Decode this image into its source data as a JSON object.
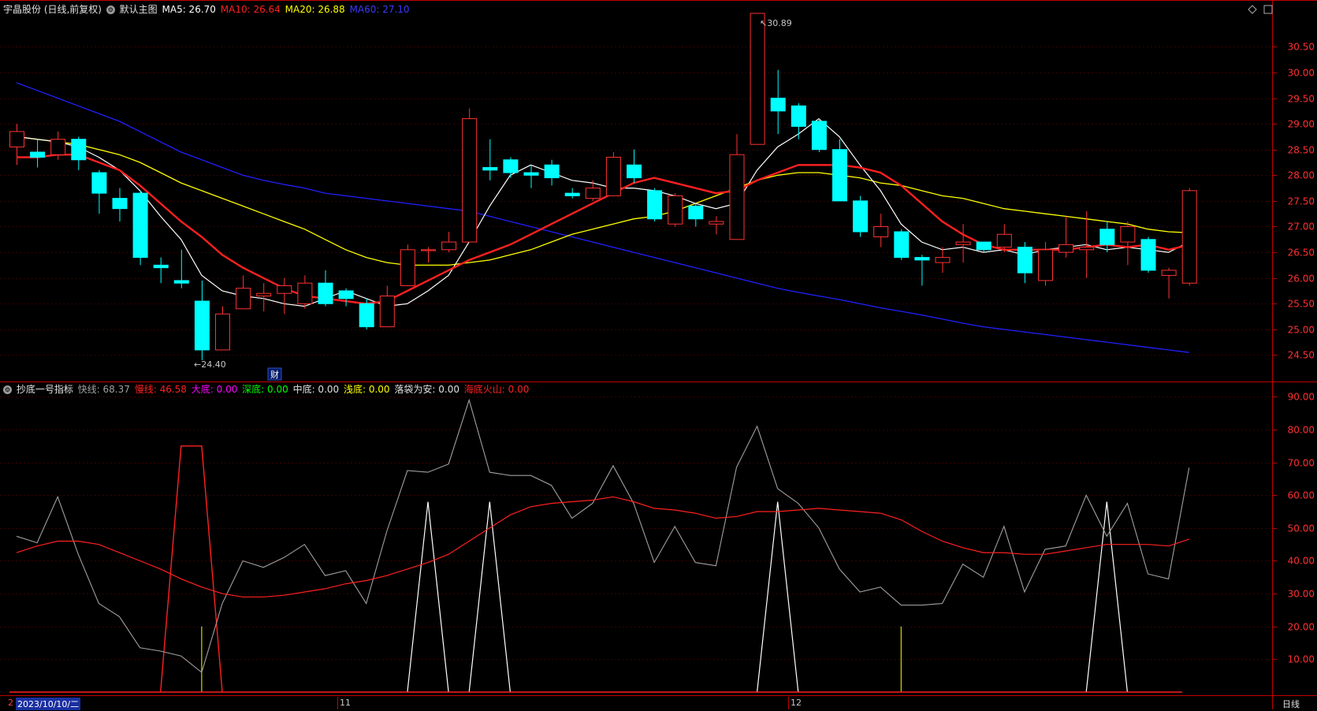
{
  "colors": {
    "background": "#000000",
    "frame": "#c00000",
    "up": "#ff3232",
    "down": "#00ffff",
    "ma5": "#ffffff",
    "ma10": "#ff2020",
    "ma20": "#ffff00",
    "ma60": "#2020ff"
  },
  "header": {
    "stock_title": "宇晶股份 (日线,前复权)",
    "template_label": "默认主图",
    "ma5": "MA5: 26.70",
    "ma10": "MA10: 26.64",
    "ma20": "MA20: 26.88",
    "ma60": "MA60: 27.10"
  },
  "indicator_header": {
    "name": "抄底一号指标",
    "fast": "快线: 68.37",
    "slow": "慢线: 46.58",
    "big_bottom": "大底: 0.00",
    "deep_bottom": "深底: 0.00",
    "mid_bottom": "中底: 0.00",
    "shallow_bottom": "浅底: 0.00",
    "safe": "落袋为安: 0.00",
    "volcano": "海底火山: 0.00"
  },
  "annotations": {
    "high_label": "30.89",
    "low_label": "24.40",
    "finance_marker": "财"
  },
  "xaxis": {
    "first_date": "2023/10/10/二",
    "month_11": "11",
    "month_12": "12",
    "period": "日线",
    "left_marker": "2"
  },
  "chart_data": [
    {
      "type": "candlestick",
      "title": "宇晶股份 (日线,前复权)",
      "ylim": [
        24.2,
        30.95
      ],
      "yticks": [
        "24.50",
        "25.00",
        "25.50",
        "26.00",
        "26.50",
        "27.00",
        "27.50",
        "28.00",
        "28.50",
        "29.00",
        "29.50",
        "30.00",
        "30.50"
      ],
      "candles": [
        [
          28.55,
          28.85,
          29.0,
          28.2
        ],
        [
          28.45,
          28.35,
          28.7,
          28.15
        ],
        [
          28.4,
          28.7,
          28.85,
          28.3
        ],
        [
          28.7,
          28.3,
          28.75,
          28.1
        ],
        [
          28.05,
          27.65,
          28.1,
          27.25
        ],
        [
          27.55,
          27.35,
          27.75,
          27.1
        ],
        [
          27.65,
          26.4,
          27.7,
          26.25
        ],
        [
          26.25,
          26.2,
          26.4,
          25.9
        ],
        [
          25.95,
          25.9,
          26.55,
          25.8
        ],
        [
          25.55,
          24.6,
          25.95,
          24.4
        ],
        [
          24.6,
          25.3,
          25.45,
          24.6
        ],
        [
          25.4,
          25.8,
          26.05,
          25.4
        ],
        [
          25.65,
          25.7,
          25.9,
          25.35
        ],
        [
          25.7,
          25.85,
          26.0,
          25.3
        ],
        [
          25.5,
          25.9,
          26.05,
          25.4
        ],
        [
          25.9,
          25.5,
          26.15,
          25.45
        ],
        [
          25.75,
          25.6,
          25.8,
          25.45
        ],
        [
          25.5,
          25.05,
          25.6,
          25.0
        ],
        [
          25.05,
          25.65,
          25.85,
          25.05
        ],
        [
          25.85,
          26.55,
          26.65,
          25.85
        ],
        [
          26.55,
          26.55,
          26.6,
          26.3
        ],
        [
          26.55,
          26.7,
          26.9,
          26.5
        ],
        [
          26.7,
          29.1,
          29.3,
          26.7
        ],
        [
          28.15,
          28.1,
          28.7,
          27.9
        ],
        [
          28.3,
          28.05,
          28.35,
          27.95
        ],
        [
          28.05,
          28.0,
          28.2,
          27.75
        ],
        [
          28.2,
          27.95,
          28.3,
          27.8
        ],
        [
          27.65,
          27.6,
          27.75,
          27.55
        ],
        [
          27.55,
          27.75,
          27.9,
          27.5
        ],
        [
          27.6,
          28.35,
          28.45,
          27.6
        ],
        [
          28.2,
          27.95,
          28.5,
          27.85
        ],
        [
          27.7,
          27.15,
          27.75,
          27.1
        ],
        [
          27.05,
          27.6,
          27.65,
          27.0
        ],
        [
          27.4,
          27.15,
          27.45,
          27.0
        ],
        [
          27.05,
          27.1,
          27.2,
          26.85
        ],
        [
          26.75,
          28.4,
          28.8,
          26.75
        ],
        [
          28.6,
          31.15,
          30.89,
          28.6
        ],
        [
          29.5,
          29.25,
          30.05,
          28.8
        ],
        [
          29.35,
          28.95,
          29.4,
          28.7
        ],
        [
          29.05,
          28.5,
          29.1,
          28.45
        ],
        [
          28.5,
          27.5,
          28.7,
          27.5
        ],
        [
          27.5,
          26.9,
          27.6,
          26.8
        ],
        [
          26.8,
          27.0,
          27.25,
          26.6
        ],
        [
          26.9,
          26.4,
          26.95,
          26.35
        ],
        [
          26.4,
          26.35,
          26.45,
          25.85
        ],
        [
          26.3,
          26.4,
          26.6,
          26.1
        ],
        [
          26.65,
          26.7,
          27.05,
          26.3
        ],
        [
          26.7,
          26.55,
          26.7,
          26.5
        ],
        [
          26.6,
          26.85,
          27.05,
          26.5
        ],
        [
          26.6,
          26.1,
          26.7,
          25.9
        ],
        [
          25.95,
          26.55,
          26.7,
          25.85
        ],
        [
          26.5,
          26.65,
          27.2,
          26.4
        ],
        [
          26.55,
          26.6,
          27.3,
          26.0
        ],
        [
          26.95,
          26.65,
          27.1,
          26.5
        ],
        [
          26.7,
          27.0,
          27.1,
          26.25
        ],
        [
          26.75,
          26.15,
          26.8,
          26.1
        ],
        [
          26.05,
          26.15,
          26.2,
          25.6
        ],
        [
          25.9,
          27.7,
          27.75,
          25.85
        ]
      ],
      "ma5": [
        28.75,
        28.7,
        28.65,
        28.55,
        28.35,
        28.1,
        27.7,
        27.2,
        26.75,
        26.05,
        25.75,
        25.65,
        25.6,
        25.5,
        25.45,
        25.6,
        25.75,
        25.6,
        25.45,
        25.5,
        25.75,
        26.05,
        26.7,
        27.4,
        28.0,
        28.2,
        28.05,
        27.9,
        27.85,
        27.75,
        27.75,
        27.7,
        27.6,
        27.45,
        27.35,
        27.45,
        28.1,
        28.55,
        28.8,
        29.1,
        28.75,
        28.2,
        27.7,
        27.05,
        26.7,
        26.55,
        26.6,
        26.5,
        26.55,
        26.45,
        26.55,
        26.6,
        26.65,
        26.55,
        26.6,
        26.55,
        26.5,
        26.7
      ],
      "ma10": [
        28.35,
        28.35,
        28.4,
        28.4,
        28.25,
        28.1,
        27.8,
        27.45,
        27.1,
        26.8,
        26.45,
        26.2,
        26.0,
        25.8,
        25.65,
        25.6,
        25.55,
        25.5,
        25.55,
        25.75,
        25.95,
        26.15,
        26.35,
        26.5,
        26.65,
        26.85,
        27.05,
        27.25,
        27.45,
        27.65,
        27.85,
        27.95,
        27.85,
        27.75,
        27.65,
        27.7,
        27.9,
        28.05,
        28.2,
        28.2,
        28.2,
        28.15,
        28.05,
        27.8,
        27.45,
        27.1,
        26.85,
        26.65,
        26.55,
        26.55,
        26.55,
        26.55,
        26.6,
        26.65,
        26.6,
        26.65,
        26.55,
        26.64
      ],
      "ma20": [
        28.75,
        28.7,
        28.65,
        28.6,
        28.5,
        28.4,
        28.25,
        28.05,
        27.85,
        27.7,
        27.55,
        27.4,
        27.25,
        27.1,
        26.95,
        26.75,
        26.55,
        26.4,
        26.3,
        26.25,
        26.25,
        26.25,
        26.3,
        26.35,
        26.45,
        26.55,
        26.7,
        26.85,
        26.95,
        27.05,
        27.15,
        27.2,
        27.3,
        27.45,
        27.6,
        27.75,
        27.9,
        28.0,
        28.05,
        28.05,
        28.0,
        27.95,
        27.85,
        27.8,
        27.7,
        27.6,
        27.55,
        27.45,
        27.35,
        27.3,
        27.25,
        27.2,
        27.15,
        27.1,
        27.05,
        26.95,
        26.9,
        26.88
      ],
      "ma60": [
        29.8,
        29.65,
        29.5,
        29.35,
        29.2,
        29.05,
        28.85,
        28.65,
        28.45,
        28.3,
        28.15,
        28.0,
        27.9,
        27.82,
        27.75,
        27.65,
        27.6,
        27.55,
        27.5,
        27.45,
        27.4,
        27.35,
        27.3,
        27.2,
        27.1,
        27.0,
        26.9,
        26.8,
        26.7,
        26.6,
        26.5,
        26.4,
        26.3,
        26.2,
        26.1,
        26.0,
        25.9,
        25.8,
        25.72,
        25.65,
        25.58,
        25.5,
        25.42,
        25.35,
        25.28,
        25.2,
        25.12,
        25.05,
        25.0,
        24.95,
        24.9,
        24.85,
        24.8,
        24.75,
        24.7,
        24.65,
        24.6,
        24.55
      ]
    },
    {
      "type": "line",
      "title": "抄底一号指标",
      "ylim": [
        0,
        92
      ],
      "yticks": [
        "10.00",
        "20.00",
        "30.00",
        "40.00",
        "50.00",
        "60.00",
        "70.00",
        "80.00",
        "90.00"
      ],
      "series": [
        {
          "name": "快线",
          "values": [
            47.5,
            45.5,
            59.5,
            42.0,
            27.0,
            23.0,
            13.5,
            12.5,
            11.0,
            6.0,
            27.0,
            40.0,
            38.0,
            41.0,
            45.0,
            35.5,
            37.0,
            27.0,
            49.0,
            67.5,
            67.0,
            69.5,
            89.0,
            67.0,
            66.0,
            66.0,
            63.0,
            53.0,
            57.5,
            69.0,
            57.5,
            39.5,
            50.5,
            39.5,
            38.5,
            68.5,
            81.0,
            62.0,
            57.5,
            50.0,
            37.5,
            30.5,
            32.0,
            26.5,
            26.5,
            27.0,
            39.0,
            35.0,
            50.5,
            30.5,
            43.5,
            44.5,
            60.0,
            47.5,
            57.5,
            36.0,
            34.5,
            68.37
          ]
        },
        {
          "name": "慢线",
          "values": [
            42.5,
            44.5,
            46.0,
            46.0,
            45.0,
            42.5,
            40.0,
            37.5,
            34.5,
            32.0,
            30.0,
            29.0,
            29.0,
            29.5,
            30.5,
            31.5,
            33.0,
            34.0,
            35.5,
            37.5,
            39.5,
            42.0,
            46.0,
            50.0,
            54.0,
            56.5,
            57.5,
            58.0,
            58.5,
            59.5,
            58.0,
            56.0,
            55.5,
            54.5,
            53.0,
            53.5,
            55.0,
            55.0,
            55.5,
            56.0,
            55.5,
            55.0,
            54.5,
            52.5,
            49.0,
            46.0,
            44.0,
            42.5,
            42.5,
            42.0,
            42.0,
            43.0,
            44.0,
            45.0,
            45.0,
            45.0,
            44.5,
            46.58
          ]
        },
        {
          "name": "大底",
          "values": [
            0,
            0,
            0,
            0,
            0,
            0,
            0,
            0,
            75,
            75,
            0,
            0,
            0,
            0,
            0,
            0,
            0,
            0,
            0,
            0,
            0,
            0,
            0,
            0,
            0,
            0,
            0,
            0,
            0,
            0,
            0,
            0,
            0,
            0,
            0,
            0,
            0,
            0,
            0,
            0,
            0,
            0,
            0,
            0,
            0,
            0,
            0,
            0,
            0,
            0,
            0,
            0,
            0,
            0,
            0,
            0,
            0,
            0
          ]
        },
        {
          "name": "落袋为安",
          "values": [
            0,
            0,
            0,
            0,
            0,
            0,
            0,
            0,
            0,
            0,
            0,
            0,
            0,
            0,
            0,
            0,
            0,
            0,
            0,
            0,
            58,
            0,
            0,
            58,
            0,
            0,
            0,
            0,
            0,
            0,
            0,
            0,
            0,
            0,
            0,
            0,
            0,
            58,
            0,
            0,
            0,
            0,
            0,
            0,
            0,
            0,
            0,
            0,
            0,
            0,
            0,
            0,
            0,
            58,
            0,
            0,
            0,
            0
          ]
        },
        {
          "name": "浅底",
          "values": [
            0,
            0,
            0,
            0,
            0,
            0,
            0,
            0,
            0,
            20,
            0,
            0,
            0,
            0,
            0,
            0,
            0,
            0,
            0,
            0,
            0,
            0,
            0,
            0,
            0,
            0,
            0,
            0,
            0,
            0,
            0,
            0,
            0,
            0,
            0,
            0,
            0,
            0,
            0,
            0,
            0,
            0,
            0,
            20,
            0,
            0,
            0,
            0,
            0,
            0,
            0,
            0,
            0,
            0,
            0,
            0,
            0,
            0
          ]
        }
      ]
    }
  ]
}
